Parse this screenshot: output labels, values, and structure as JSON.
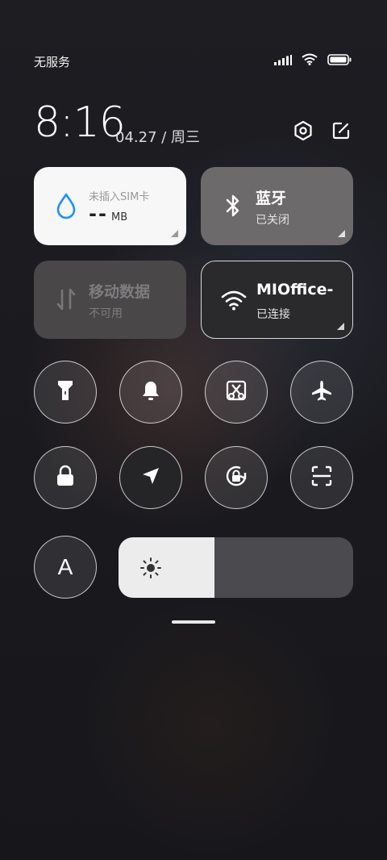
{
  "status_bar": {
    "carrier": "无服务",
    "icons": [
      "signal-icon",
      "wifi-icon",
      "battery-icon"
    ],
    "battery_percent": 100
  },
  "header": {
    "time": "8:16",
    "date": "04.27 / 周三",
    "buttons": [
      "settings-icon",
      "edit-icon"
    ]
  },
  "tiles": {
    "data": {
      "title": "未插入SIM卡",
      "value": "--",
      "unit": "MB",
      "icon": "water-drop-icon",
      "accent": "#1e90ff"
    },
    "bluetooth": {
      "title": "蓝牙",
      "status": "已关闭",
      "icon": "bluetooth-icon"
    },
    "mobile_data": {
      "title": "移动数据",
      "status": "不可用",
      "icon": "data-arrows-icon"
    },
    "wifi": {
      "title": "MIOffice-",
      "status": "已连接",
      "icon": "wifi-icon"
    }
  },
  "toggles": [
    {
      "name": "flashlight",
      "icon": "flashlight-icon",
      "active": false
    },
    {
      "name": "mute",
      "icon": "bell-icon",
      "active": false
    },
    {
      "name": "screenshot",
      "icon": "scissors-icon",
      "active": false
    },
    {
      "name": "airplane",
      "icon": "airplane-icon",
      "active": false
    },
    {
      "name": "lock-screen",
      "icon": "lock-icon",
      "active": false
    },
    {
      "name": "location",
      "icon": "location-arrow-icon",
      "active": false
    },
    {
      "name": "rotation-lock",
      "icon": "rotation-lock-icon",
      "active": false
    },
    {
      "name": "scanner",
      "icon": "scan-icon",
      "active": false
    },
    {
      "name": "auto-brightness",
      "label": "A",
      "icon": "auto-brightness-icon",
      "active": false
    }
  ],
  "brightness": {
    "level": 0.41,
    "icon": "sun-icon"
  },
  "colors": {
    "tile_light": "#f7f7f7",
    "tile_dark": "#2a2a2c",
    "bt_tile": "#6d6a6c"
  }
}
